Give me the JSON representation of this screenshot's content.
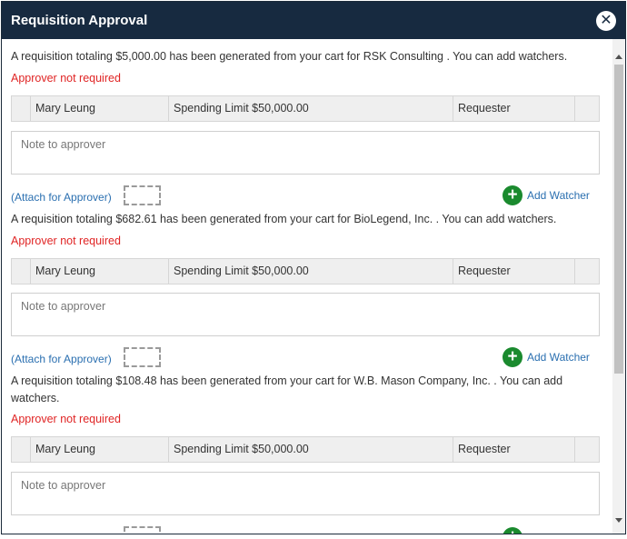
{
  "dialog": {
    "title": "Requisition Approval",
    "close_glyph": "✕"
  },
  "requisitions": [
    {
      "message": "A requisition totaling $5,000.00 has been generated from your cart for RSK Consulting . You can add watchers.",
      "approver_status": "Approver not required",
      "approver": {
        "name": "Mary Leung",
        "limit": "Spending Limit $50,000.00",
        "role": "Requester"
      },
      "note_placeholder": "Note to approver",
      "attach_label": "(Attach for Approver)",
      "add_watcher_label": "Add Watcher"
    },
    {
      "message": "A requisition totaling $682.61 has been generated from your cart for BioLegend, Inc. . You can add watchers.",
      "approver_status": "Approver not required",
      "approver": {
        "name": "Mary Leung",
        "limit": "Spending Limit $50,000.00",
        "role": "Requester"
      },
      "note_placeholder": "Note to approver",
      "attach_label": "(Attach for Approver)",
      "add_watcher_label": "Add Watcher"
    },
    {
      "message": "A requisition totaling $108.48 has been generated from your cart for W.B. Mason Company, Inc. . You can add watchers.",
      "approver_status": "Approver not required",
      "approver": {
        "name": "Mary Leung",
        "limit": "Spending Limit $50,000.00",
        "role": "Requester"
      },
      "note_placeholder": "Note to approver"
    }
  ],
  "icons": {
    "plus": "plus-icon",
    "close": "close-icon"
  },
  "colors": {
    "header_bg": "#172a40",
    "status_red": "#e02424",
    "link_blue": "#2a6fb0",
    "watcher_green": "#1a8a2e"
  }
}
